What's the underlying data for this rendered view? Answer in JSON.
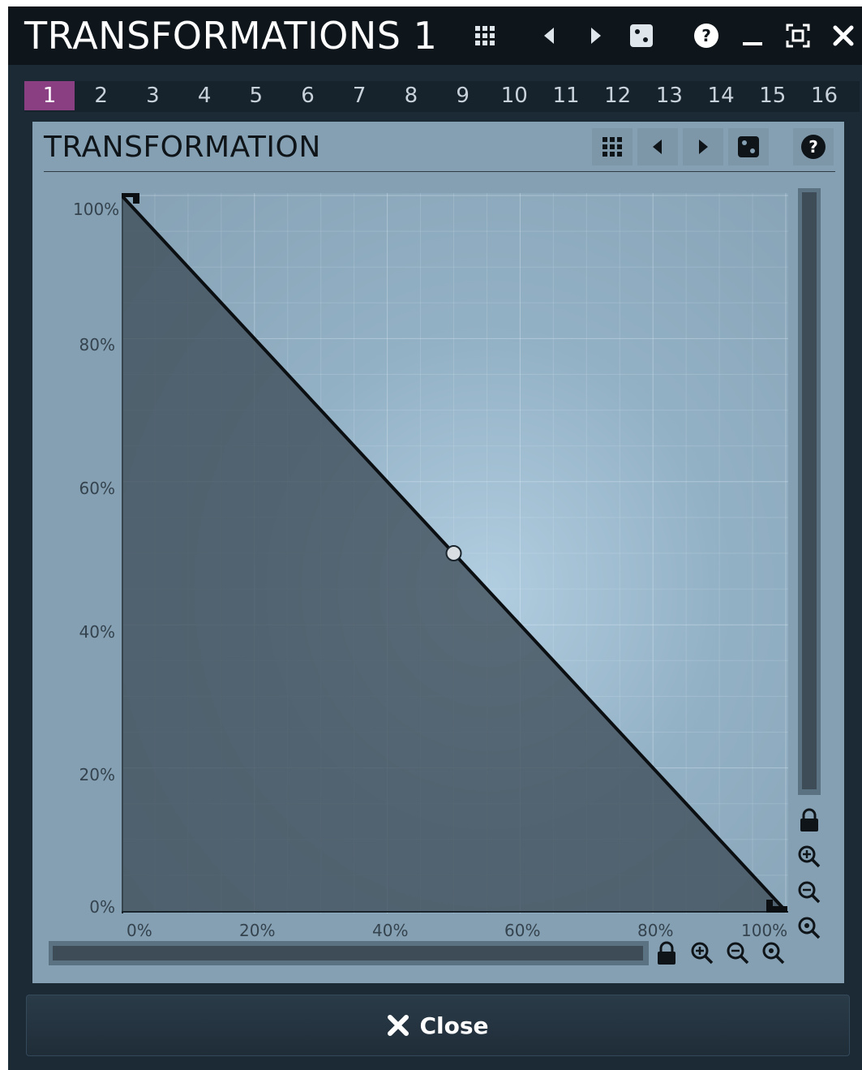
{
  "window": {
    "title": "TRANSFORMATIONS 1",
    "icons": [
      "grid-icon",
      "prev-icon",
      "next-icon",
      "random-icon",
      "help-icon",
      "minimize-icon",
      "maximize-icon",
      "close-icon"
    ]
  },
  "tabs": {
    "items": [
      "1",
      "2",
      "3",
      "4",
      "5",
      "6",
      "7",
      "8",
      "9",
      "10",
      "11",
      "12",
      "13",
      "14",
      "15",
      "16"
    ],
    "active": "1",
    "active_color": "#8a3f83"
  },
  "panel": {
    "title": "TRANSFORMATION",
    "icons": [
      "grid-icon",
      "prev-icon",
      "next-icon",
      "random-icon",
      "help-icon"
    ]
  },
  "graph": {
    "y_ticks": [
      "100%",
      "80%",
      "60%",
      "40%",
      "20%",
      "0%"
    ],
    "x_ticks": [
      "0%",
      "20%",
      "40%",
      "60%",
      "80%",
      "100%"
    ],
    "curve_points": [
      [
        0,
        100
      ],
      [
        50,
        50
      ],
      [
        100,
        0
      ]
    ],
    "fill_color": "#3f4d58",
    "line_color": "#0b0f12"
  },
  "zoom_controls": {
    "icons": [
      "lock-icon",
      "zoom-in-icon",
      "zoom-out-icon",
      "zoom-reset-icon"
    ]
  },
  "footer": {
    "close_label": "Close"
  }
}
